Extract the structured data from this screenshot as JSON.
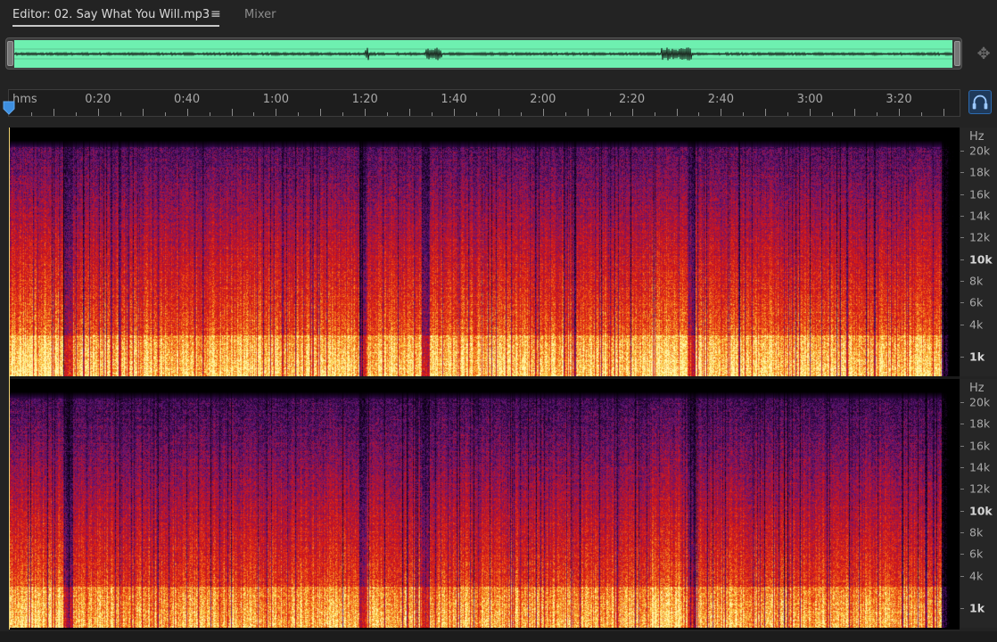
{
  "tabs": {
    "editor_label": "Editor: 02. Say What You Will.mp3",
    "mixer_label": "Mixer"
  },
  "icons": {
    "panel_menu": "hamburger-menu-icon",
    "zoom_navigator": "zoom-navigator-icon",
    "playhead": "playhead-marker-icon",
    "monitor": "headphones-icon"
  },
  "ruler": {
    "unit": "hms",
    "labels": [
      "0:20",
      "0:40",
      "1:00",
      "1:20",
      "1:40",
      "2:00",
      "2:20",
      "2:40",
      "3:00",
      "3:20"
    ],
    "label_seconds": [
      20,
      40,
      60,
      80,
      100,
      120,
      140,
      160,
      180,
      200
    ],
    "duration_seconds": 210
  },
  "frequency_axis": {
    "unit": "Hz",
    "labels": [
      {
        "text": "20k",
        "hz": 20000,
        "bold": false
      },
      {
        "text": "18k",
        "hz": 18000,
        "bold": false
      },
      {
        "text": "16k",
        "hz": 16000,
        "bold": false
      },
      {
        "text": "14k",
        "hz": 14000,
        "bold": false
      },
      {
        "text": "12k",
        "hz": 12000,
        "bold": false
      },
      {
        "text": "10k",
        "hz": 10000,
        "bold": true
      },
      {
        "text": "8k",
        "hz": 8000,
        "bold": false
      },
      {
        "text": "6k",
        "hz": 6000,
        "bold": false
      },
      {
        "text": "4k",
        "hz": 4000,
        "bold": false
      },
      {
        "text": "1k",
        "hz": 1000,
        "bold": true
      }
    ]
  },
  "colors": {
    "overview_wave": "#6ef0b0",
    "accent": "#2d6bb0",
    "cursor": "#f0d270"
  }
}
